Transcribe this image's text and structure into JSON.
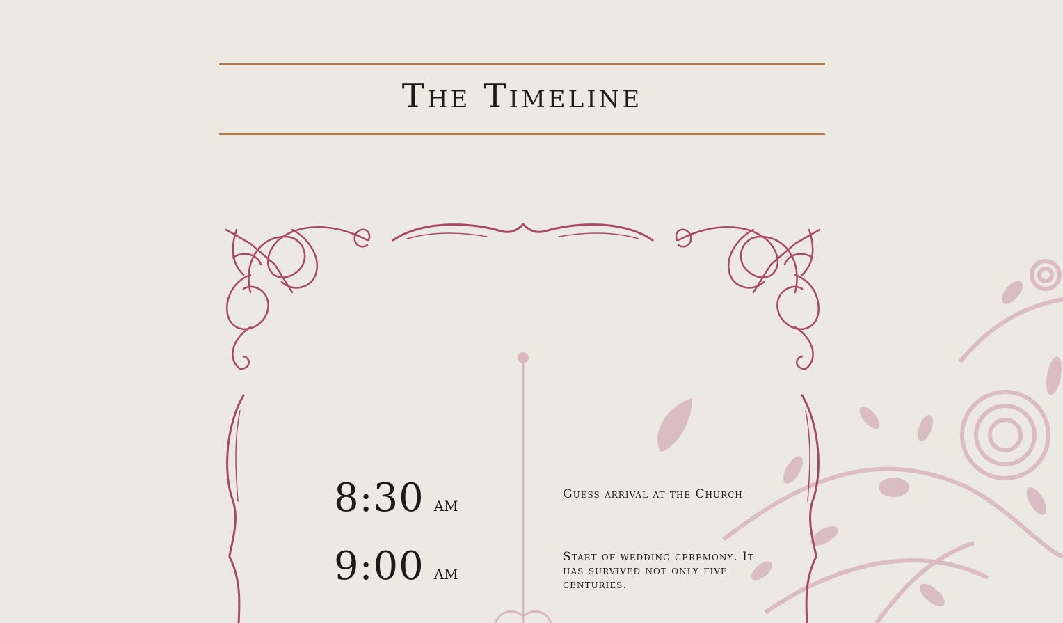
{
  "section": {
    "title": "The Timeline"
  },
  "colors": {
    "background": "#ece8e2",
    "rule": "#b07a4d",
    "ornament": "#a84a62",
    "floral": "#d9b8bf"
  },
  "timeline": [
    {
      "time": "8:30",
      "period": "AM",
      "description": "Guess arrival at the Church"
    },
    {
      "time": "9:00",
      "period": "AM",
      "description": "Start of wedding ceremony. It has survived not only five centuries."
    }
  ]
}
